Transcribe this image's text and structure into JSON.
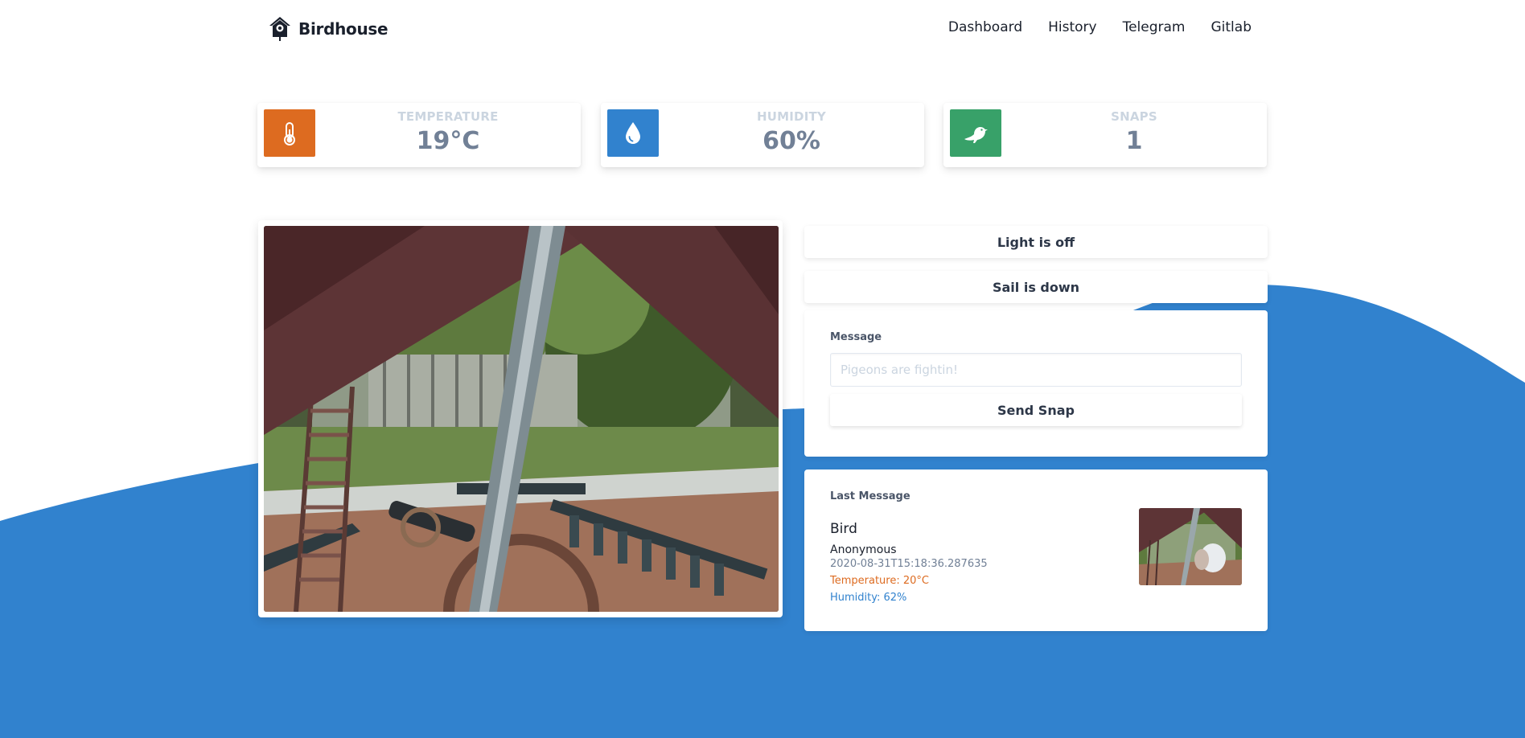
{
  "nav": {
    "brand": "Birdhouse",
    "links": [
      "Dashboard",
      "History",
      "Telegram",
      "Gitlab"
    ]
  },
  "stats": [
    {
      "label": "TEMPERATURE",
      "value": "19°C",
      "icon": "thermometer-icon",
      "color": "#dd6b20"
    },
    {
      "label": "HUMIDITY",
      "value": "60%",
      "icon": "water-drop-icon",
      "color": "#3182ce"
    },
    {
      "label": "SNAPS",
      "value": "1",
      "icon": "bird-icon",
      "color": "#38a169"
    }
  ],
  "controls": {
    "light": "Light is off",
    "sail": "Sail is down"
  },
  "message_form": {
    "label": "Message",
    "placeholder": "Pigeons are fightin!",
    "value": "",
    "button": "Send Snap"
  },
  "last_message": {
    "label": "Last Message",
    "title": "Bird",
    "author": "Anonymous",
    "timestamp": "2020-08-31T15:18:36.287635",
    "temperature": "Temperature: 20°C",
    "humidity": "Humidity: 62%"
  },
  "colors": {
    "wave": "#3182ce",
    "temperature": "#dd6b20",
    "humidity": "#3182ce",
    "snaps": "#38a169"
  }
}
